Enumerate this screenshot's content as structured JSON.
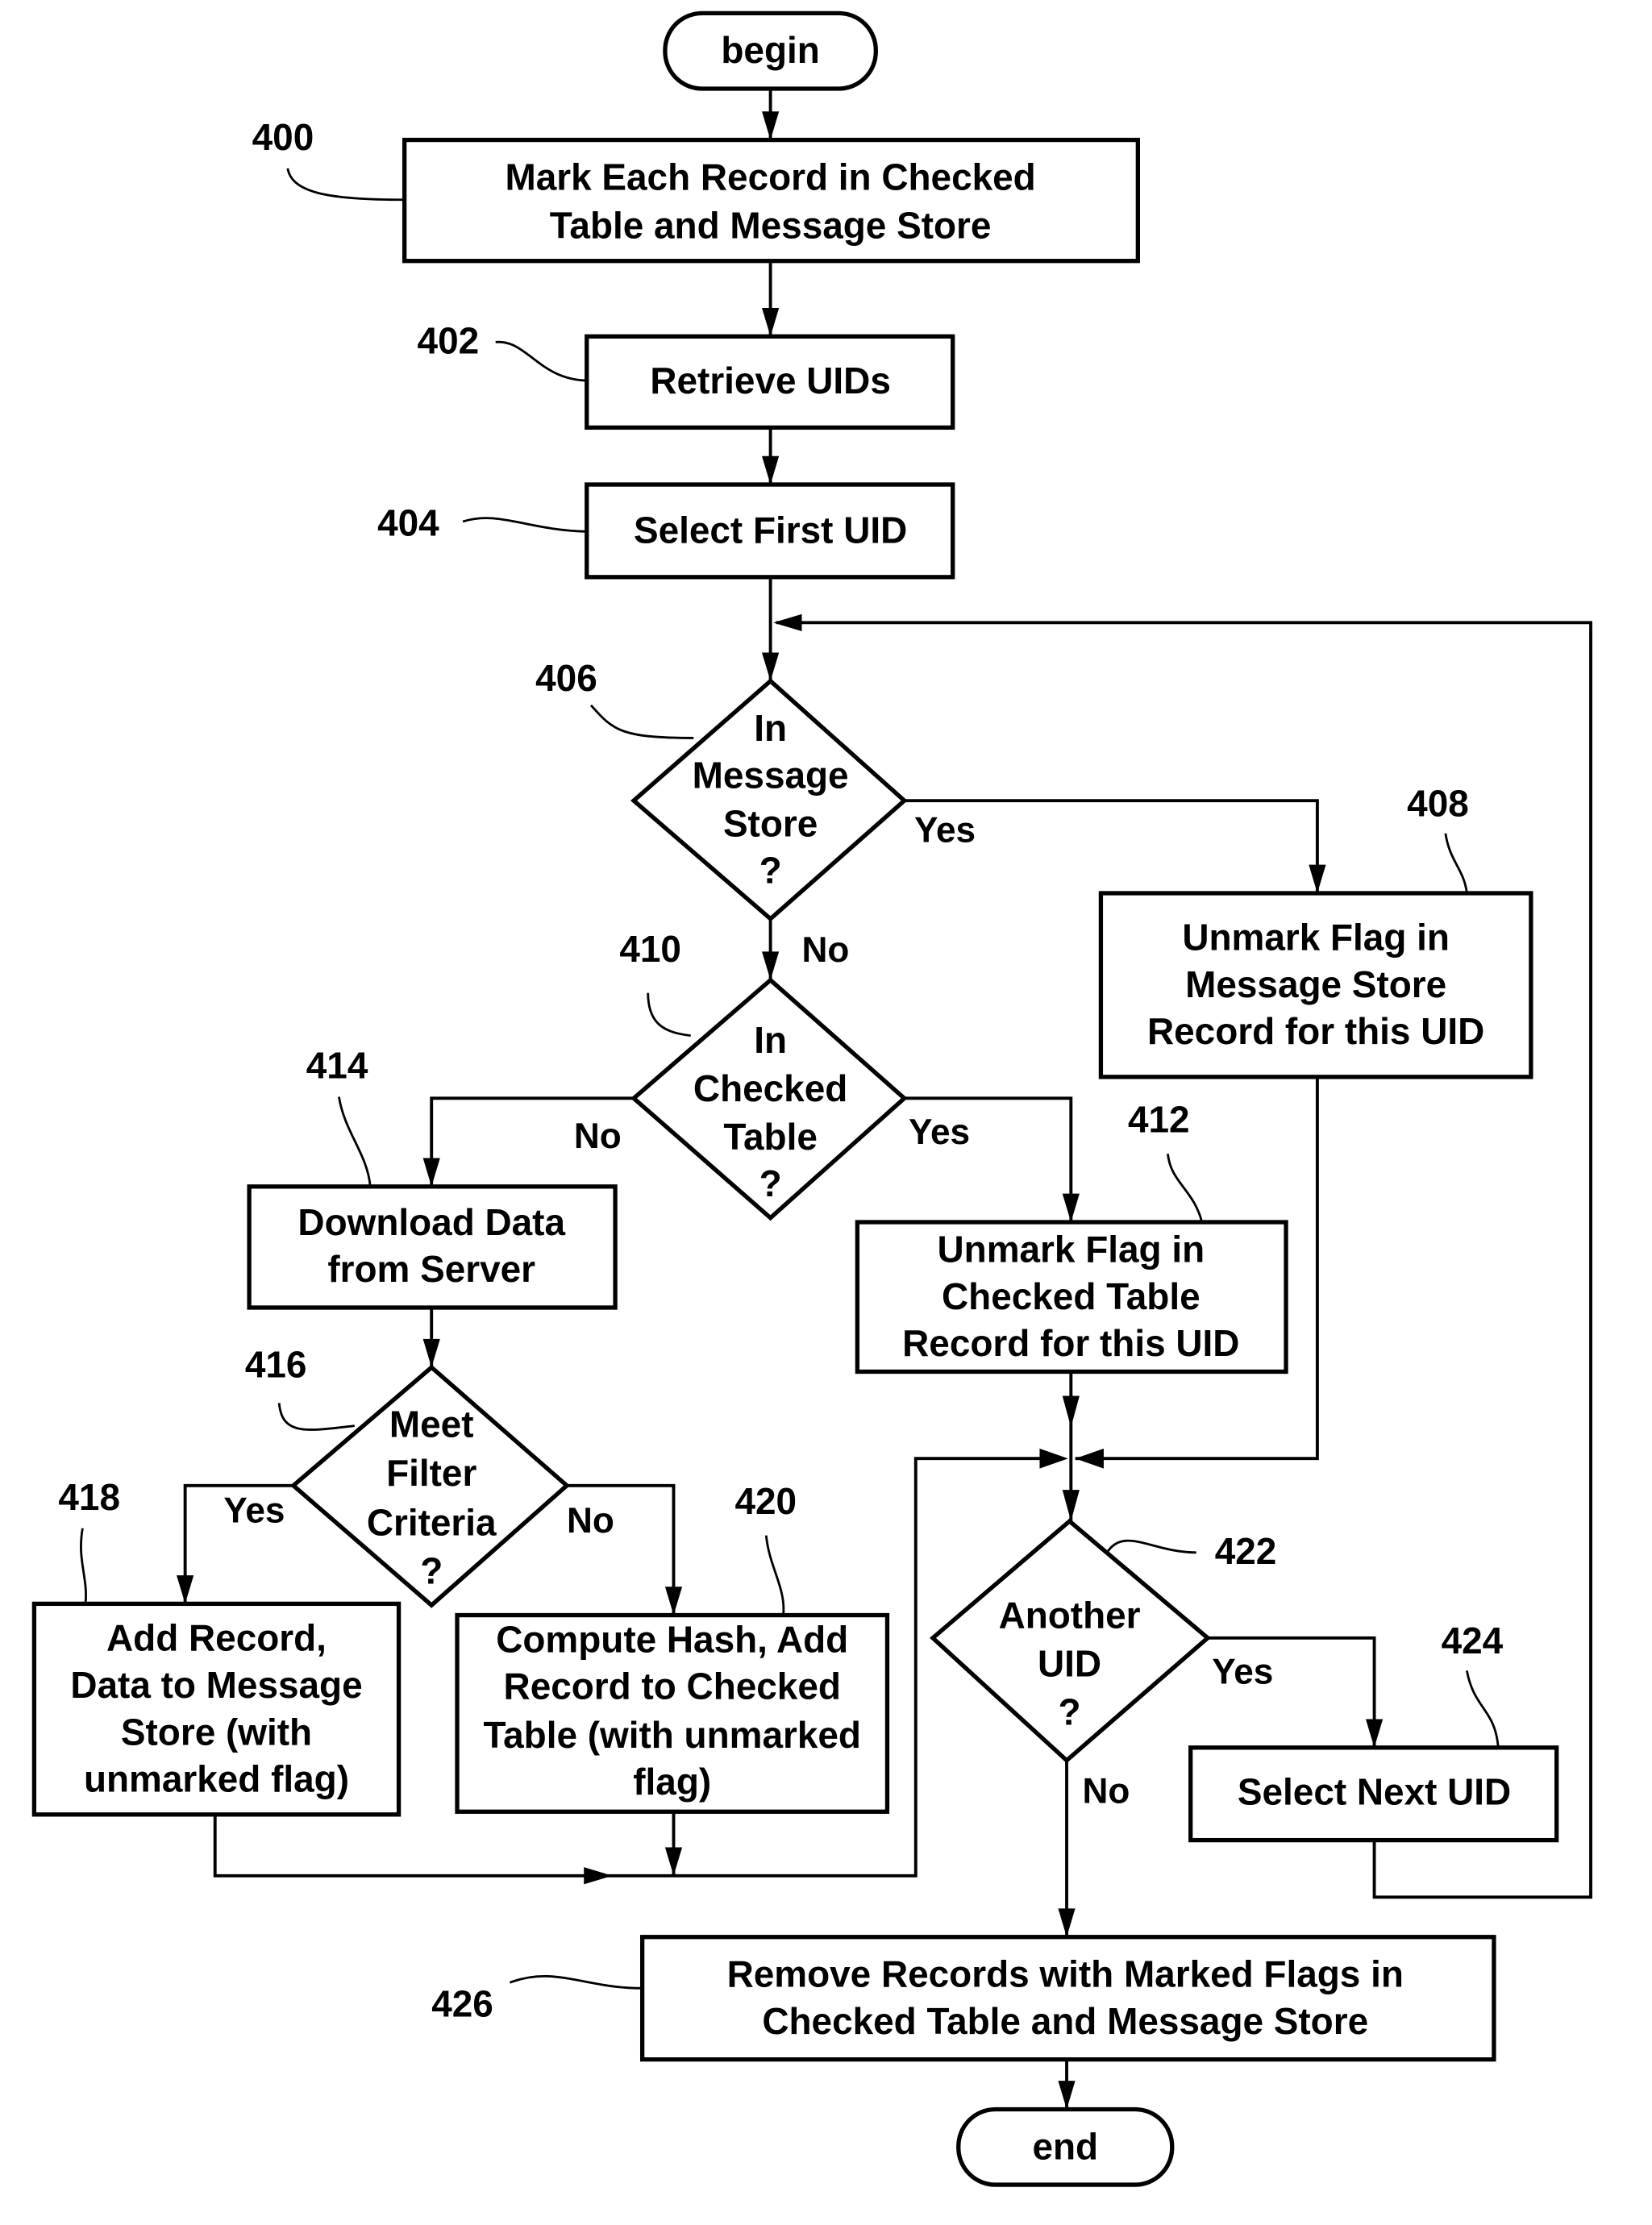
{
  "diagram": {
    "type": "flowchart",
    "terminals": {
      "begin": "begin",
      "end": "end"
    },
    "steps": {
      "s400": {
        "ref": "400",
        "lines": [
          "Mark Each Record in Checked",
          "Table and Message Store"
        ]
      },
      "s402": {
        "ref": "402",
        "lines": [
          "Retrieve UIDs"
        ]
      },
      "s404": {
        "ref": "404",
        "lines": [
          "Select First UID"
        ]
      },
      "s406": {
        "ref": "406",
        "lines": [
          "In",
          "Message",
          "Store",
          "?"
        ]
      },
      "s408": {
        "ref": "408",
        "lines": [
          "Unmark Flag in",
          "Message Store",
          "Record for this UID"
        ]
      },
      "s410": {
        "ref": "410",
        "lines": [
          "In",
          "Checked",
          "Table",
          "?"
        ]
      },
      "s412": {
        "ref": "412",
        "lines": [
          "Unmark Flag in",
          "Checked Table",
          "Record for this UID"
        ]
      },
      "s414": {
        "ref": "414",
        "lines": [
          "Download Data",
          "from Server"
        ]
      },
      "s416": {
        "ref": "416",
        "lines": [
          "Meet",
          "Filter",
          "Criteria",
          "?"
        ]
      },
      "s418": {
        "ref": "418",
        "lines": [
          "Add Record,",
          "Data to Message",
          "Store (with",
          "unmarked flag)"
        ]
      },
      "s420": {
        "ref": "420",
        "lines": [
          "Compute Hash, Add",
          "Record to Checked",
          "Table (with unmarked",
          "flag)"
        ]
      },
      "s422": {
        "ref": "422",
        "lines": [
          "Another",
          "UID",
          "?"
        ]
      },
      "s424": {
        "ref": "424",
        "lines": [
          "Select  Next UID"
        ]
      },
      "s426": {
        "ref": "426",
        "lines": [
          "Remove Records with Marked Flags in",
          "Checked Table and Message Store"
        ]
      }
    },
    "branch_labels": {
      "yes": "Yes",
      "no": "No"
    }
  }
}
